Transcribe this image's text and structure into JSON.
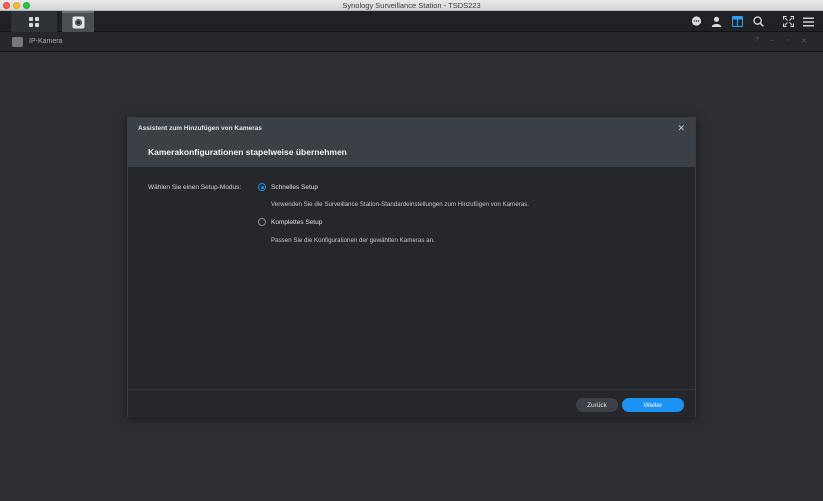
{
  "window": {
    "title": "Synology Surveillance Station - TSDS223"
  },
  "subbar": {
    "title": "IP-Kamera"
  },
  "dialog": {
    "caption": "Assistent zum Hinzufügen von Kameras",
    "title": "Kamerakonfigurationen stapelweise übernehmen",
    "mode_label": "Wählen Sie einen Setup-Modus:",
    "options": [
      {
        "label": "Schnelles Setup",
        "description": "Verwenden Sie die Surveillance Station-Standardeinstellungen zum Hinzufügen von Kameras.",
        "selected": true
      },
      {
        "label": "Komplettes Setup",
        "description": "Passen Sie die Konfigurationen der gewählten Kameras an.",
        "selected": false
      }
    ],
    "back_label": "Zurück",
    "next_label": "Weiter"
  },
  "colors": {
    "accent": "#1c92f2",
    "dialog_header": "#3b3f46",
    "background": "#2d2f33"
  },
  "icons": [
    "grid-icon",
    "camera-icon",
    "chat-icon",
    "user-icon",
    "layout-icon",
    "search-icon",
    "fullscreen-icon",
    "menu-icon"
  ]
}
